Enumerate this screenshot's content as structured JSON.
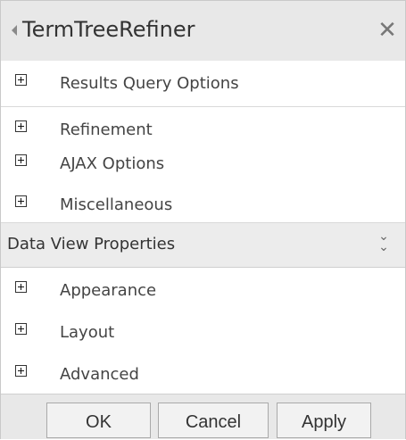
{
  "panel": {
    "title": "TermTreeRefiner",
    "close_glyph": "✕"
  },
  "sections_top": [
    {
      "label": "Results Query Options"
    },
    {
      "label": "Refinement"
    },
    {
      "label": "AJAX Options"
    },
    {
      "label": "Miscellaneous"
    }
  ],
  "header": {
    "label": "Data View Properties",
    "toggle_glyph": "⌄"
  },
  "sections_bottom": [
    {
      "label": "Appearance"
    },
    {
      "label": "Layout"
    },
    {
      "label": "Advanced"
    }
  ],
  "footer": {
    "ok_label": "OK",
    "cancel_label": "Cancel",
    "apply_label": "Apply"
  },
  "colors": {
    "title_bar_bg": "#e8e8e8",
    "header_bg": "#ececec",
    "text": "#333333"
  },
  "icons": {
    "title_arrow": "collapse-arrow-icon",
    "close": "close-icon",
    "expand": "plus-box-icon",
    "toggle": "double-chevron-down-icon"
  }
}
